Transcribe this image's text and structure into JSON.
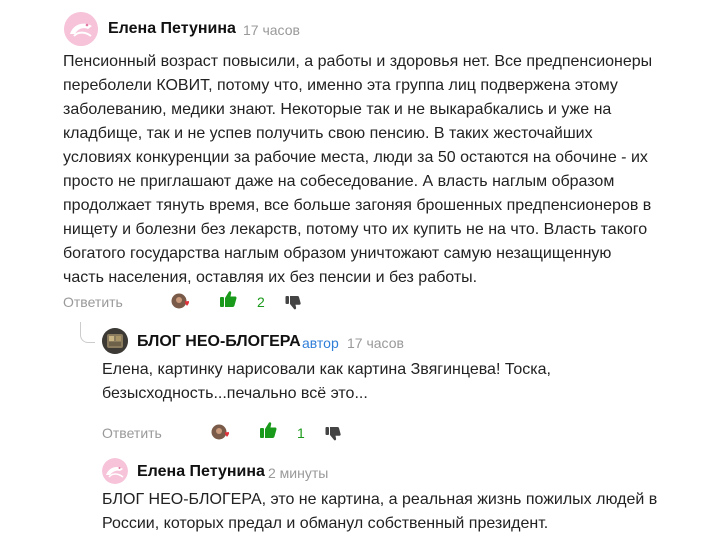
{
  "comments": [
    {
      "author": "Елена Петунина",
      "time": "17 часов",
      "text_lines": [
        "Пенсионный возраст повысили, а работы и здоровья нет. Все предпенсионеры",
        "переболели КОВИТ, потому что, именно эта группа лиц подвержена этому",
        "заболеванию, медики знают. Некоторые так и не выкарабкались и уже на",
        "кладбище, так и не успев получить свою пенсию. В таких жесточайших",
        "условиях конкуренции за рабочие места, люди за 50 остаются на обочине - их",
        "просто не приглашают даже на собеседование. А власть наглым образом",
        "продолжает тянуть время, все больше загоняя брошенных предпенсионеров в",
        "нищету и болезни без лекарств, потому что их купить не на что. Власть такого",
        "богатого государства наглым образом уничтожают самую незащищенную",
        "часть населения, оставляя их без пенсии и без работы."
      ],
      "reply_label": "Ответить",
      "likes": "2"
    },
    {
      "author": "БЛОГ НЕО-БЛОГЕРА",
      "author_tag": "автор",
      "time": "17 часов",
      "text_lines": [
        "Елена, картинку нарисовали как картина Звягинцева! Тоска,",
        "безысходность...печально всё это..."
      ],
      "reply_label": "Ответить",
      "likes": "1"
    },
    {
      "author": "Елена Петунина",
      "time": "2 минуты",
      "text_lines": [
        "БЛОГ НЕО-БЛОГЕРА, это не картина, а реальная жизнь пожилых людей в",
        "России, которых предал и обманул собственный президент."
      ]
    }
  ],
  "icons": {
    "like": "thumbs-up-icon",
    "dislike": "thumbs-down-icon",
    "reaction": "liked-avatar-heart-icon"
  },
  "colors": {
    "like_green": "#1a9a1a",
    "author_tag_blue": "#2f7ed8",
    "muted": "#999999",
    "dislike_gray": "#444444"
  }
}
